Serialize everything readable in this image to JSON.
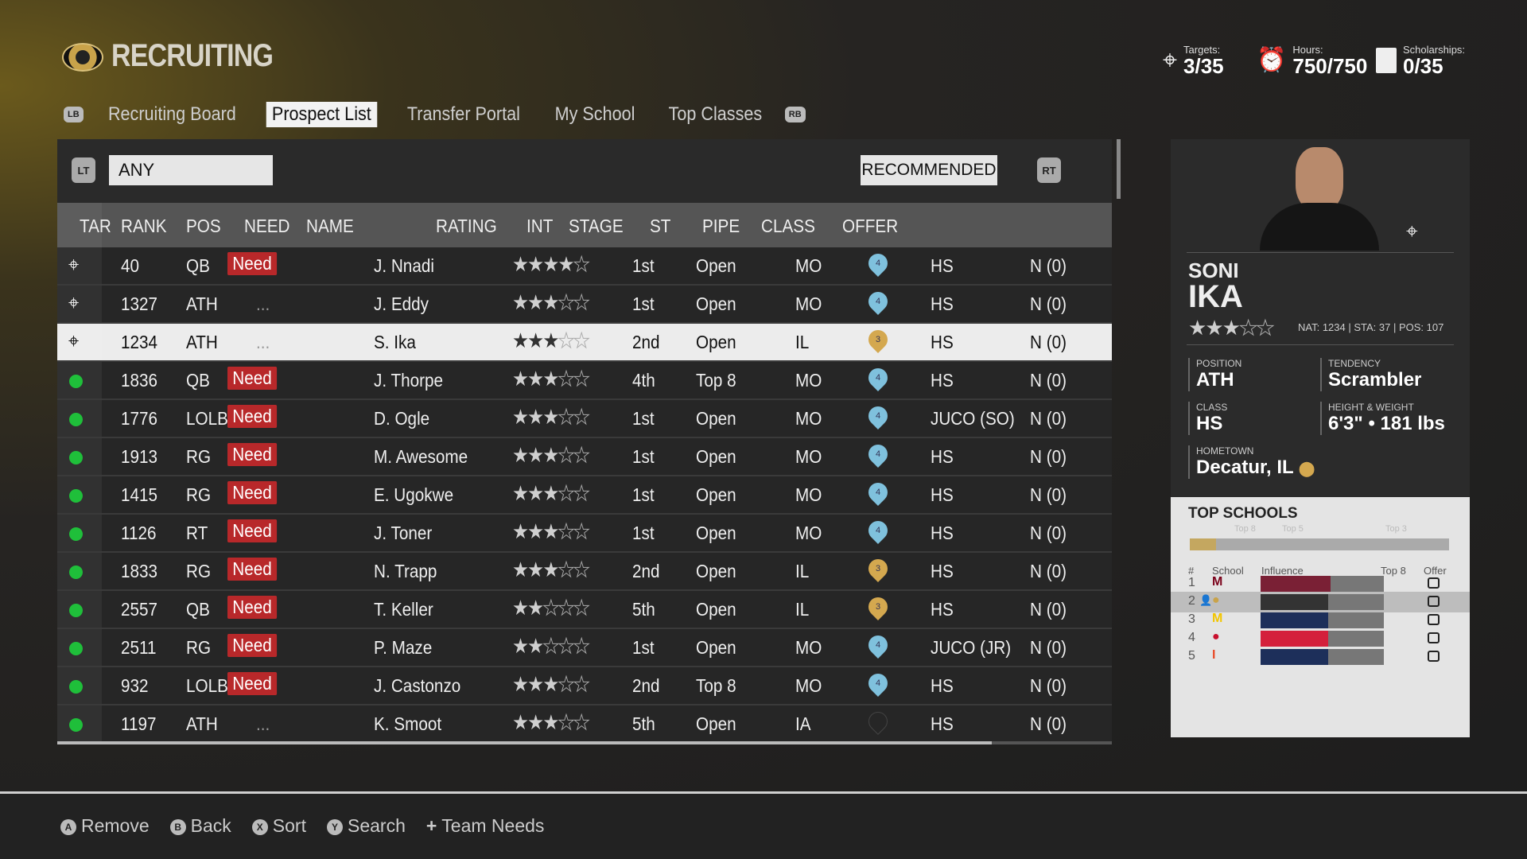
{
  "header": {
    "title": "RECRUITING",
    "logo": "missouri-tiger-logo",
    "stats": [
      {
        "label": "Targets:",
        "value": "3/35",
        "icon": "crosshair-icon"
      },
      {
        "label": "Hours:",
        "value": "750/750",
        "icon": "alarm-clock-icon"
      },
      {
        "label": "Scholarships:",
        "value": "0/35",
        "icon": "scholarship-document-icon"
      }
    ]
  },
  "tabs": {
    "left_bumper": "LB",
    "right_bumper": "RB",
    "items": [
      "Recruiting Board",
      "Prospect List",
      "Transfer Portal",
      "My School",
      "Top Classes"
    ],
    "active": "Prospect List"
  },
  "filters": {
    "left_trigger": "LT",
    "right_trigger": "RT",
    "position_filter": "ANY",
    "sort": "RECOMMENDED"
  },
  "table": {
    "columns": [
      "TAR",
      "RANK",
      "POS",
      "NEED",
      "NAME",
      "RATING",
      "INT",
      "STAGE",
      "ST",
      "PIPE",
      "CLASS",
      "OFFER"
    ],
    "rows": [
      {
        "tar": "target",
        "rank": "40",
        "pos": "QB",
        "need": "Need",
        "name": "J. Nnadi",
        "stars": 4,
        "int": "1st",
        "stage": "Open",
        "st": "MO",
        "pipe": "4",
        "pipe_color": "#7fc1dd",
        "class": "HS",
        "offer": "N (0)"
      },
      {
        "tar": "target",
        "rank": "1327",
        "pos": "ATH",
        "need": "...",
        "name": "J. Eddy",
        "stars": 3,
        "int": "1st",
        "stage": "Open",
        "st": "MO",
        "pipe": "4",
        "pipe_color": "#7fc1dd",
        "class": "HS",
        "offer": "N (0)"
      },
      {
        "tar": "target",
        "rank": "1234",
        "pos": "ATH",
        "need": "...",
        "name": "S. Ika",
        "stars": 3,
        "int": "2nd",
        "stage": "Open",
        "st": "IL",
        "pipe": "3",
        "pipe_color": "#d4a84f",
        "class": "HS",
        "offer": "N (0)",
        "selected": true
      },
      {
        "tar": "dot",
        "rank": "1836",
        "pos": "QB",
        "need": "Need",
        "name": "J. Thorpe",
        "stars": 3,
        "int": "4th",
        "stage": "Top 8",
        "st": "MO",
        "pipe": "4",
        "pipe_color": "#7fc1dd",
        "class": "HS",
        "offer": "N (0)"
      },
      {
        "tar": "dot",
        "rank": "1776",
        "pos": "LOLB",
        "need": "Need",
        "name": "D. Ogle",
        "stars": 3,
        "int": "1st",
        "stage": "Open",
        "st": "MO",
        "pipe": "4",
        "pipe_color": "#7fc1dd",
        "class": "JUCO (SO)",
        "offer": "N (0)"
      },
      {
        "tar": "dot",
        "rank": "1913",
        "pos": "RG",
        "need": "Need",
        "name": "M. Awesome",
        "stars": 3,
        "int": "1st",
        "stage": "Open",
        "st": "MO",
        "pipe": "4",
        "pipe_color": "#7fc1dd",
        "class": "HS",
        "offer": "N (0)"
      },
      {
        "tar": "dot",
        "rank": "1415",
        "pos": "RG",
        "need": "Need",
        "name": "E. Ugokwe",
        "stars": 3,
        "int": "1st",
        "stage": "Open",
        "st": "MO",
        "pipe": "4",
        "pipe_color": "#7fc1dd",
        "class": "HS",
        "offer": "N (0)"
      },
      {
        "tar": "dot",
        "rank": "1126",
        "pos": "RT",
        "need": "Need",
        "name": "J. Toner",
        "stars": 3,
        "int": "1st",
        "stage": "Open",
        "st": "MO",
        "pipe": "4",
        "pipe_color": "#7fc1dd",
        "class": "HS",
        "offer": "N (0)"
      },
      {
        "tar": "dot",
        "rank": "1833",
        "pos": "RG",
        "need": "Need",
        "name": "N. Trapp",
        "stars": 3,
        "int": "2nd",
        "stage": "Open",
        "st": "IL",
        "pipe": "3",
        "pipe_color": "#d4a84f",
        "class": "HS",
        "offer": "N (0)"
      },
      {
        "tar": "dot",
        "rank": "2557",
        "pos": "QB",
        "need": "Need",
        "name": "T. Keller",
        "stars": 2,
        "int": "5th",
        "stage": "Open",
        "st": "IL",
        "pipe": "3",
        "pipe_color": "#d4a84f",
        "class": "HS",
        "offer": "N (0)"
      },
      {
        "tar": "dot",
        "rank": "2511",
        "pos": "RG",
        "need": "Need",
        "name": "P. Maze",
        "stars": 2,
        "int": "1st",
        "stage": "Open",
        "st": "MO",
        "pipe": "4",
        "pipe_color": "#7fc1dd",
        "class": "JUCO (JR)",
        "offer": "N (0)"
      },
      {
        "tar": "dot",
        "rank": "932",
        "pos": "LOLB",
        "need": "Need",
        "name": "J. Castonzo",
        "stars": 3,
        "int": "2nd",
        "stage": "Top 8",
        "st": "MO",
        "pipe": "4",
        "pipe_color": "#7fc1dd",
        "class": "HS",
        "offer": "N (0)"
      },
      {
        "tar": "dot",
        "rank": "1197",
        "pos": "ATH",
        "need": "...",
        "name": "K. Smoot",
        "stars": 3,
        "int": "5th",
        "stage": "Open",
        "st": "IA",
        "pipe": "",
        "pipe_color": "",
        "class": "HS",
        "offer": "N (0)"
      }
    ]
  },
  "player": {
    "first": "SONI",
    "last": "IKA",
    "stars": 3,
    "meta": "NAT: 1234 | STA: 37 | POS: 107",
    "position_label": "POSITION",
    "position": "ATH",
    "tendency_label": "TENDENCY",
    "tendency": "Scrambler",
    "class_label": "CLASS",
    "class": "HS",
    "hw_label": "HEIGHT & WEIGHT",
    "hw": "6'3\" • 181 lbs",
    "hometown_label": "HOMETOWN",
    "hometown": "Decatur, IL"
  },
  "top_schools": {
    "title": "TOP SCHOOLS",
    "stages": [
      "Top 8",
      "Top 5",
      "Top 3"
    ],
    "progress": 0.1,
    "headers": [
      "#",
      "School",
      "Influence",
      "Top 8",
      "Offer"
    ],
    "rows": [
      {
        "rank": "1",
        "school": "Minnesota",
        "logo": "M",
        "logo_color": "#7a0019",
        "bar_color": "#7a2035",
        "influence": 0.57
      },
      {
        "rank": "2",
        "school": "Missouri",
        "logo": "tiger",
        "logo_color": "#c9a34a",
        "bar_color": "#333",
        "influence": 0.55,
        "selected": true
      },
      {
        "rank": "3",
        "school": "Michigan",
        "logo": "M",
        "logo_color": "#f2c500",
        "bar_color": "#1d2f5a",
        "influence": 0.55
      },
      {
        "rank": "4",
        "school": "Louisville",
        "logo": "cardinal",
        "logo_color": "#c8102e",
        "bar_color": "#d4203c",
        "influence": 0.55
      },
      {
        "rank": "5",
        "school": "Illinois",
        "logo": "I",
        "logo_color": "#e84a27",
        "bar_color": "#1d2f5a",
        "influence": 0.55
      }
    ]
  },
  "hints": [
    {
      "btn": "A",
      "label": "Remove"
    },
    {
      "btn": "B",
      "label": "Back"
    },
    {
      "btn": "X",
      "label": "Sort"
    },
    {
      "btn": "Y",
      "label": "Search"
    },
    {
      "btn": "+",
      "label": "Team Needs"
    }
  ]
}
